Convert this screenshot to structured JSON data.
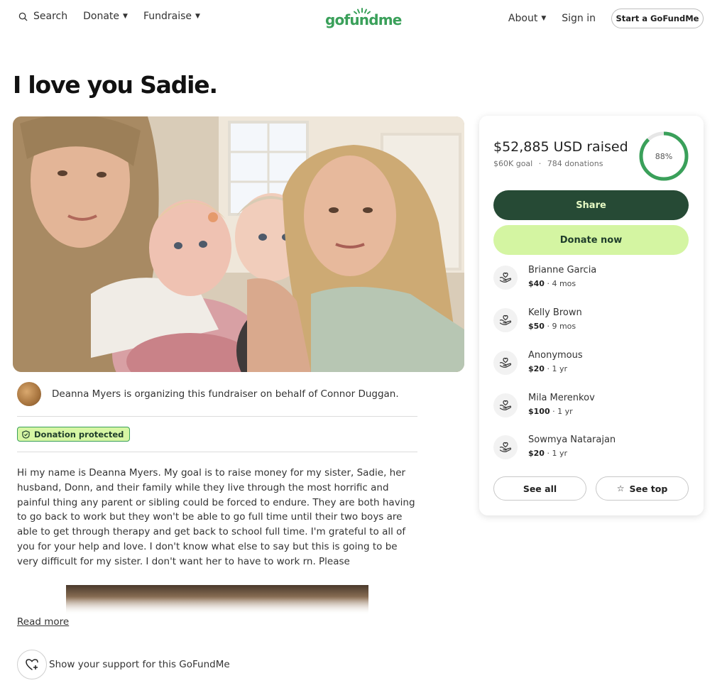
{
  "header": {
    "search_label": "Search",
    "donate_label": "Donate",
    "fundraise_label": "Fundraise",
    "logo_text": "gofundme",
    "about_label": "About",
    "signin_label": "Sign in",
    "start_label": "Start a GoFundMe"
  },
  "campaign": {
    "title": "I love you Sadie.",
    "organizer_text": "Deanna Myers is organizing this fundraiser on behalf of Connor Duggan.",
    "badge_label": "Donation protected",
    "story": "Hi my name is Deanna Myers. My goal is to raise money for my sister, Sadie, her husband, Donn, and their family while they live through the most horrific and painful thing any parent or sibling could be forced to endure. They are both having to go back to work but they won't be able to go full time until their two boys are able to get through therapy and get back to school full time. I'm grateful to all of you for your help and love. I don't know what else to say but this is going to be very difficult for my sister. I don't want her to have to work rn. Please",
    "read_more": "Read more",
    "support_text": "Show your support for this GoFundMe"
  },
  "card": {
    "raised": "$52,885 USD raised",
    "goal": "$60K goal",
    "separator": "·",
    "donations": "784 donations",
    "progress_label": "88%",
    "progress_value": 0.88,
    "share_label": "Share",
    "donate_label": "Donate now",
    "see_all_label": "See all",
    "see_top_label": "See top",
    "donors": [
      {
        "name": "Brianne Garcia",
        "amount": "$40",
        "time": " · 4 mos"
      },
      {
        "name": "Kelly Brown",
        "amount": "$50",
        "time": " · 9 mos"
      },
      {
        "name": "Anonymous",
        "amount": "$20",
        "time": " · 1 yr"
      },
      {
        "name": "Mila Merenkov",
        "amount": "$100",
        "time": " · 1 yr"
      },
      {
        "name": "Sowmya Natarajan",
        "amount": "$20",
        "time": " · 1 yr"
      }
    ]
  },
  "colors": {
    "brand_green": "#3aa05a",
    "share_bg": "#264a35",
    "donate_bg": "#d4f5a2",
    "badge_bg": "#d7f6a4"
  },
  "icons": [
    "search-icon",
    "caret-down-icon",
    "shield-icon",
    "hand-heart-icon",
    "heart-plus-icon",
    "star-icon"
  ]
}
